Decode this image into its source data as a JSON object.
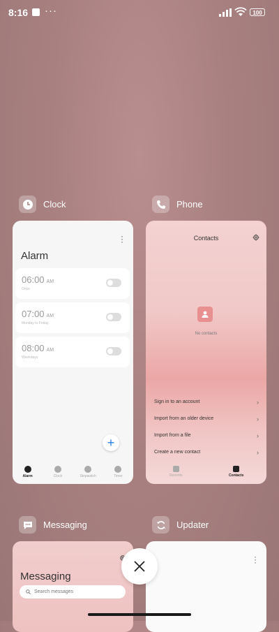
{
  "status_bar": {
    "time": "8:16",
    "more": "···",
    "battery": "100"
  },
  "apps": {
    "clock": {
      "name": "Clock",
      "title": "Alarm",
      "alarms": [
        {
          "time": "06:00",
          "ampm": "AM",
          "label": "Once",
          "enabled": false
        },
        {
          "time": "07:00",
          "ampm": "AM",
          "label": "Monday to Friday",
          "enabled": false
        },
        {
          "time": "08:00",
          "ampm": "AM",
          "label": "Weekdays",
          "enabled": false
        }
      ],
      "add_label": "+",
      "nav": [
        "Alarm",
        "Clock",
        "Stopwatch",
        "Timer"
      ]
    },
    "phone": {
      "name": "Phone",
      "title": "Contacts",
      "empty_text": "No contacts",
      "options": [
        "Sign in to an account",
        "Import from an older device",
        "Import from a file",
        "Create a new contact"
      ],
      "nav": [
        "Recents",
        "Contacts"
      ]
    },
    "messaging": {
      "name": "Messaging",
      "title": "Messaging",
      "search_placeholder": "Search messages"
    },
    "updater": {
      "name": "Updater"
    }
  },
  "colors": {
    "accent": "#2b7de0",
    "contact_icon": "#e8908f"
  }
}
